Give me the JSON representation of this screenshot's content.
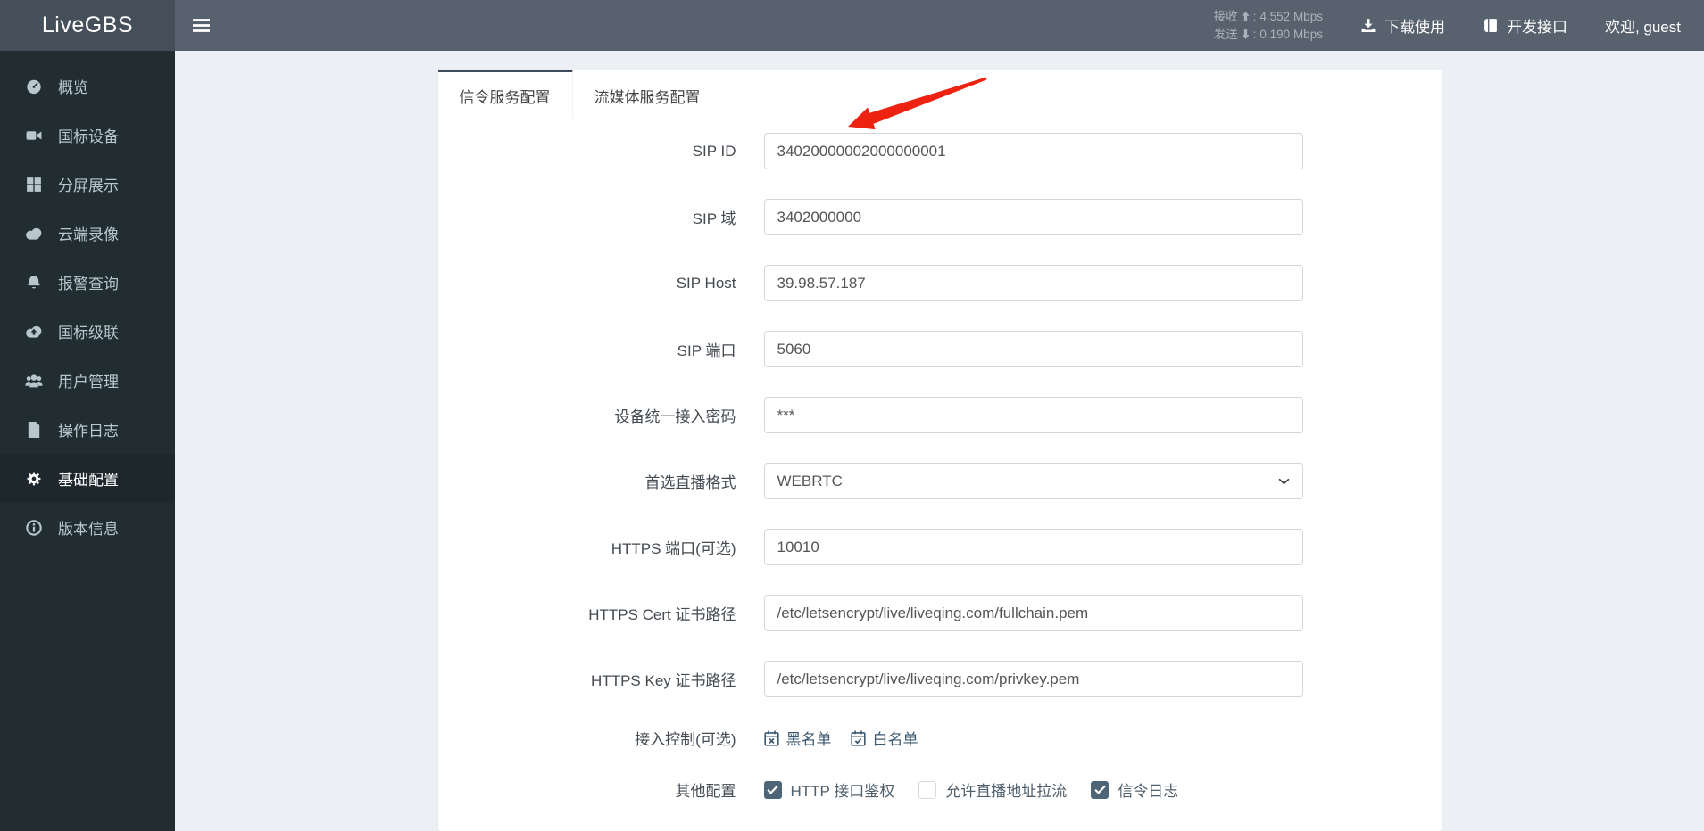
{
  "colors": {
    "header_bg": "#57626e",
    "logo_bg": "#454f5a",
    "sidebar_bg": "#222d32",
    "sidebar_active_bg": "#1e282c",
    "tab_accent": "#3e4b59",
    "link_blue": "#3c5870",
    "checkbox_checked": "#4e6477",
    "annotation_red": "#ee2211"
  },
  "header": {
    "brand": "LiveGBS",
    "stats": [
      {
        "label": "接收",
        "dir": "up",
        "sep": " : ",
        "value": "4.552 Mbps"
      },
      {
        "label": "发送",
        "dir": "down",
        "sep": " : ",
        "value": "0.190 Mbps"
      }
    ],
    "actions": [
      {
        "id": "download",
        "label": "下载使用",
        "icon": "download-icon"
      },
      {
        "id": "api-docs",
        "label": "开发接口",
        "icon": "book-icon"
      }
    ],
    "welcome": "欢迎, guest"
  },
  "sidebar": {
    "items": [
      {
        "id": "overview",
        "label": "概览",
        "icon": "dashboard-icon",
        "active": false
      },
      {
        "id": "gb-devices",
        "label": "国标设备",
        "icon": "video-camera-icon",
        "active": false
      },
      {
        "id": "split-screen",
        "label": "分屏展示",
        "icon": "grid-icon",
        "active": false
      },
      {
        "id": "cloud-record",
        "label": "云端录像",
        "icon": "cloud-icon",
        "active": false
      },
      {
        "id": "alarm-query",
        "label": "报警查询",
        "icon": "bell-icon",
        "active": false
      },
      {
        "id": "gb-cascade",
        "label": "国标级联",
        "icon": "cloud-upload-icon",
        "active": false
      },
      {
        "id": "user-mgmt",
        "label": "用户管理",
        "icon": "users-icon",
        "active": false
      },
      {
        "id": "op-log",
        "label": "操作日志",
        "icon": "file-icon",
        "active": false
      },
      {
        "id": "basic-config",
        "label": "基础配置",
        "icon": "gears-icon",
        "active": true
      },
      {
        "id": "version-info",
        "label": "版本信息",
        "icon": "info-circle-icon",
        "active": false
      }
    ]
  },
  "main": {
    "tabs": [
      {
        "id": "signal-config",
        "label": "信令服务配置",
        "active": true
      },
      {
        "id": "media-config",
        "label": "流媒体服务配置",
        "active": false
      }
    ],
    "form": {
      "fields": [
        {
          "id": "sip-id",
          "label": "SIP ID",
          "type": "text",
          "value": "34020000002000000001"
        },
        {
          "id": "sip-domain",
          "label": "SIP 域",
          "type": "text",
          "value": "3402000000"
        },
        {
          "id": "sip-host",
          "label": "SIP Host",
          "type": "text",
          "value": "39.98.57.187"
        },
        {
          "id": "sip-port",
          "label": "SIP 端口",
          "type": "text",
          "value": "5060"
        },
        {
          "id": "device-password",
          "label": "设备统一接入密码",
          "type": "text",
          "value": "***"
        },
        {
          "id": "live-format",
          "label": "首选直播格式",
          "type": "select",
          "value": "WEBRTC"
        },
        {
          "id": "https-port",
          "label": "HTTPS 端口(可选)",
          "type": "text",
          "value": "10010"
        },
        {
          "id": "https-cert",
          "label": "HTTPS Cert 证书路径",
          "type": "text",
          "value": "/etc/letsencrypt/live/liveqing.com/fullchain.pem"
        },
        {
          "id": "https-key",
          "label": "HTTPS Key 证书路径",
          "type": "text",
          "value": "/etc/letsencrypt/live/liveqing.com/privkey.pem"
        }
      ],
      "access_control": {
        "label": "接入控制(可选)",
        "links": [
          {
            "id": "blacklist",
            "label": "黑名单",
            "icon": "calendar-times-icon"
          },
          {
            "id": "whitelist",
            "label": "白名单",
            "icon": "calendar-check-icon"
          }
        ]
      },
      "other_config": {
        "label": "其他配置",
        "options": [
          {
            "id": "http-auth",
            "label": "HTTP 接口鉴权",
            "checked": true
          },
          {
            "id": "allow-url-pull",
            "label": "允许直播地址拉流",
            "checked": false
          },
          {
            "id": "signal-log",
            "label": "信令日志",
            "checked": true
          }
        ]
      }
    }
  }
}
